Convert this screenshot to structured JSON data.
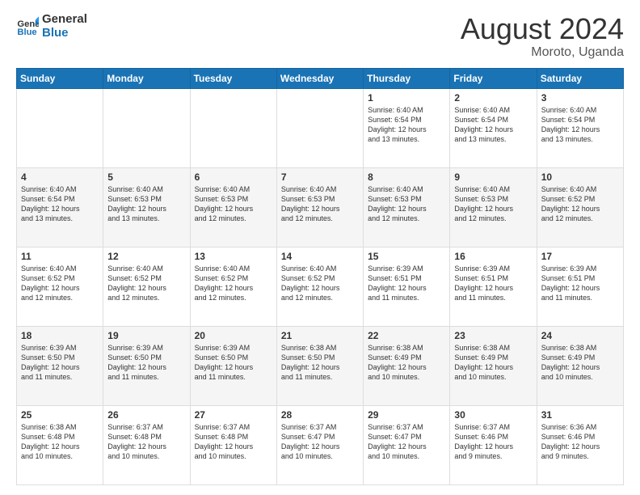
{
  "logo": {
    "line1": "General",
    "line2": "Blue"
  },
  "title": "August 2024",
  "location": "Moroto, Uganda",
  "days_of_week": [
    "Sunday",
    "Monday",
    "Tuesday",
    "Wednesday",
    "Thursday",
    "Friday",
    "Saturday"
  ],
  "weeks": [
    [
      {
        "day": "",
        "info": ""
      },
      {
        "day": "",
        "info": ""
      },
      {
        "day": "",
        "info": ""
      },
      {
        "day": "",
        "info": ""
      },
      {
        "day": "1",
        "info": "Sunrise: 6:40 AM\nSunset: 6:54 PM\nDaylight: 12 hours\nand 13 minutes."
      },
      {
        "day": "2",
        "info": "Sunrise: 6:40 AM\nSunset: 6:54 PM\nDaylight: 12 hours\nand 13 minutes."
      },
      {
        "day": "3",
        "info": "Sunrise: 6:40 AM\nSunset: 6:54 PM\nDaylight: 12 hours\nand 13 minutes."
      }
    ],
    [
      {
        "day": "4",
        "info": "Sunrise: 6:40 AM\nSunset: 6:54 PM\nDaylight: 12 hours\nand 13 minutes."
      },
      {
        "day": "5",
        "info": "Sunrise: 6:40 AM\nSunset: 6:53 PM\nDaylight: 12 hours\nand 13 minutes."
      },
      {
        "day": "6",
        "info": "Sunrise: 6:40 AM\nSunset: 6:53 PM\nDaylight: 12 hours\nand 12 minutes."
      },
      {
        "day": "7",
        "info": "Sunrise: 6:40 AM\nSunset: 6:53 PM\nDaylight: 12 hours\nand 12 minutes."
      },
      {
        "day": "8",
        "info": "Sunrise: 6:40 AM\nSunset: 6:53 PM\nDaylight: 12 hours\nand 12 minutes."
      },
      {
        "day": "9",
        "info": "Sunrise: 6:40 AM\nSunset: 6:53 PM\nDaylight: 12 hours\nand 12 minutes."
      },
      {
        "day": "10",
        "info": "Sunrise: 6:40 AM\nSunset: 6:52 PM\nDaylight: 12 hours\nand 12 minutes."
      }
    ],
    [
      {
        "day": "11",
        "info": "Sunrise: 6:40 AM\nSunset: 6:52 PM\nDaylight: 12 hours\nand 12 minutes."
      },
      {
        "day": "12",
        "info": "Sunrise: 6:40 AM\nSunset: 6:52 PM\nDaylight: 12 hours\nand 12 minutes."
      },
      {
        "day": "13",
        "info": "Sunrise: 6:40 AM\nSunset: 6:52 PM\nDaylight: 12 hours\nand 12 minutes."
      },
      {
        "day": "14",
        "info": "Sunrise: 6:40 AM\nSunset: 6:52 PM\nDaylight: 12 hours\nand 12 minutes."
      },
      {
        "day": "15",
        "info": "Sunrise: 6:39 AM\nSunset: 6:51 PM\nDaylight: 12 hours\nand 11 minutes."
      },
      {
        "day": "16",
        "info": "Sunrise: 6:39 AM\nSunset: 6:51 PM\nDaylight: 12 hours\nand 11 minutes."
      },
      {
        "day": "17",
        "info": "Sunrise: 6:39 AM\nSunset: 6:51 PM\nDaylight: 12 hours\nand 11 minutes."
      }
    ],
    [
      {
        "day": "18",
        "info": "Sunrise: 6:39 AM\nSunset: 6:50 PM\nDaylight: 12 hours\nand 11 minutes."
      },
      {
        "day": "19",
        "info": "Sunrise: 6:39 AM\nSunset: 6:50 PM\nDaylight: 12 hours\nand 11 minutes."
      },
      {
        "day": "20",
        "info": "Sunrise: 6:39 AM\nSunset: 6:50 PM\nDaylight: 12 hours\nand 11 minutes."
      },
      {
        "day": "21",
        "info": "Sunrise: 6:38 AM\nSunset: 6:50 PM\nDaylight: 12 hours\nand 11 minutes."
      },
      {
        "day": "22",
        "info": "Sunrise: 6:38 AM\nSunset: 6:49 PM\nDaylight: 12 hours\nand 10 minutes."
      },
      {
        "day": "23",
        "info": "Sunrise: 6:38 AM\nSunset: 6:49 PM\nDaylight: 12 hours\nand 10 minutes."
      },
      {
        "day": "24",
        "info": "Sunrise: 6:38 AM\nSunset: 6:49 PM\nDaylight: 12 hours\nand 10 minutes."
      }
    ],
    [
      {
        "day": "25",
        "info": "Sunrise: 6:38 AM\nSunset: 6:48 PM\nDaylight: 12 hours\nand 10 minutes."
      },
      {
        "day": "26",
        "info": "Sunrise: 6:37 AM\nSunset: 6:48 PM\nDaylight: 12 hours\nand 10 minutes."
      },
      {
        "day": "27",
        "info": "Sunrise: 6:37 AM\nSunset: 6:48 PM\nDaylight: 12 hours\nand 10 minutes."
      },
      {
        "day": "28",
        "info": "Sunrise: 6:37 AM\nSunset: 6:47 PM\nDaylight: 12 hours\nand 10 minutes."
      },
      {
        "day": "29",
        "info": "Sunrise: 6:37 AM\nSunset: 6:47 PM\nDaylight: 12 hours\nand 10 minutes."
      },
      {
        "day": "30",
        "info": "Sunrise: 6:37 AM\nSunset: 6:46 PM\nDaylight: 12 hours\nand 9 minutes."
      },
      {
        "day": "31",
        "info": "Sunrise: 6:36 AM\nSunset: 6:46 PM\nDaylight: 12 hours\nand 9 minutes."
      }
    ]
  ]
}
